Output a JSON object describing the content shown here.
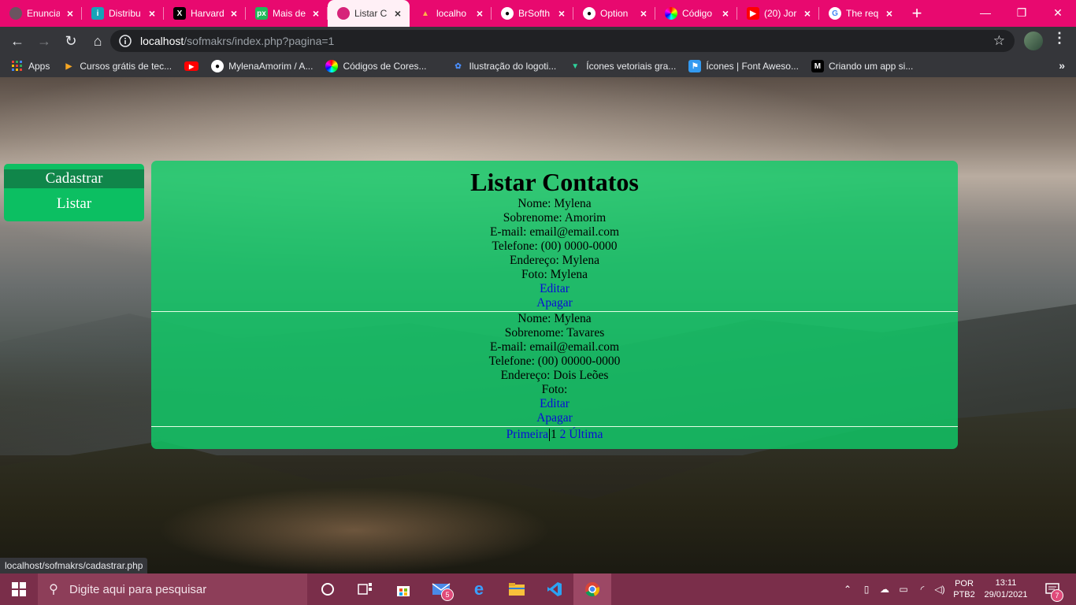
{
  "browser": {
    "tabs": [
      {
        "label": "Enuncia",
        "favicon_color": "#6b5460",
        "icon": "globe-icon"
      },
      {
        "label": "Distribu",
        "favicon_color": "#16a4b8",
        "icon": "distribution-icon"
      },
      {
        "label": "Harvard",
        "favicon_color": "#000000",
        "icon": "harvard-x-icon"
      },
      {
        "label": "Mais de",
        "favicon_color": "#1fba5a",
        "icon": "px-icon"
      },
      {
        "label": "Listar C",
        "favicon_color": "#d6247a",
        "icon": "localhost-icon",
        "active": true
      },
      {
        "label": "localho",
        "favicon_color": "#e8096f",
        "icon": "xampp-icon"
      },
      {
        "label": "BrSofth",
        "favicon_color": "#e8096f",
        "icon": "github-icon"
      },
      {
        "label": "Option",
        "favicon_color": "#e8096f",
        "icon": "github-icon"
      },
      {
        "label": "Código",
        "favicon_color": "#ffffff",
        "icon": "color-wheel-icon"
      },
      {
        "label": "(20) Jor",
        "favicon_color": "#ff0000",
        "icon": "youtube-icon"
      },
      {
        "label": "The req",
        "favicon_color": "#ffffff",
        "icon": "google-icon"
      }
    ],
    "url_host": "localhost",
    "url_path": "/sofmakrs/index.php?pagina=1",
    "bookmarks": [
      {
        "label": "Apps",
        "icon": "apps-grid-icon"
      },
      {
        "label": "Cursos grátis de tec...",
        "icon": "course-icon"
      },
      {
        "label": "",
        "icon": "youtube-icon"
      },
      {
        "label": "MylenaAmorim / A...",
        "icon": "github-icon"
      },
      {
        "label": "Códigos de Cores...",
        "icon": "color-wheel-icon"
      },
      {
        "label": "Ilustração do logoti...",
        "icon": "logo-illustration-icon"
      },
      {
        "label": "Ícones vetoriais gra...",
        "icon": "vector-icons-icon"
      },
      {
        "label": "Ícones | Font Aweso...",
        "icon": "font-awesome-icon"
      },
      {
        "label": "Criando um app si...",
        "icon": "medium-icon"
      }
    ],
    "status_url": "localhost/sofmakrs/cadastrar.php"
  },
  "menu": {
    "cadastrar": "Cadastrar",
    "listar": "Listar"
  },
  "page": {
    "title": "Listar Contatos",
    "contacts": [
      {
        "nome": "Nome: Mylena",
        "sobrenome": "Sobrenome: Amorim",
        "email": "E-mail: email@email.com",
        "telefone": "Telefone: (00) 0000-0000",
        "endereco": "Endereço: Mylena",
        "foto": "Foto: Mylena",
        "editar": "Editar",
        "apagar": "Apagar"
      },
      {
        "nome": "Nome: Mylena",
        "sobrenome": "Sobrenome: Tavares",
        "email": "E-mail: email@email.com",
        "telefone": "Telefone: (00) 00000-0000",
        "endereco": "Endereço: Dois Leões",
        "foto": "Foto:",
        "editar": "Editar",
        "apagar": "Apagar"
      }
    ],
    "pager": {
      "first": "Primeira",
      "page1": "1",
      "page2": "2",
      "last": "Última"
    }
  },
  "taskbar": {
    "search_placeholder": "Digite aqui para pesquisar",
    "mail_badge": "5",
    "lang_line1": "POR",
    "lang_line2": "PTB2",
    "time": "13:11",
    "date": "29/01/2021",
    "notif_badge": "7"
  }
}
